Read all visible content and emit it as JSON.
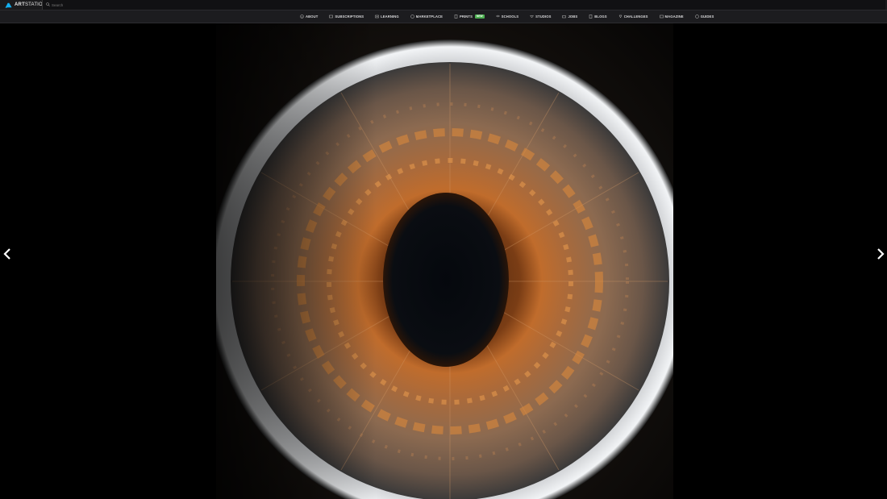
{
  "topbar": {
    "brand_prefix": "ART",
    "brand_suffix": "STATION",
    "search_placeholder": "Search"
  },
  "nav": {
    "items": [
      {
        "label": "ABOUT",
        "icon": "info-icon"
      },
      {
        "label": "SUBSCRIPTIONS",
        "icon": "card-icon"
      },
      {
        "label": "LEARNING",
        "icon": "play-icon"
      },
      {
        "label": "MARKETPLACE",
        "icon": "store-icon"
      },
      {
        "label": "PRINTS",
        "icon": "print-icon",
        "badge": "NEW"
      },
      {
        "label": "SCHOOLS",
        "icon": "school-icon"
      },
      {
        "label": "STUDIOS",
        "icon": "studio-icon"
      },
      {
        "label": "JOBS",
        "icon": "briefcase-icon"
      },
      {
        "label": "BLOGS",
        "icon": "blog-icon"
      },
      {
        "label": "CHALLENGES",
        "icon": "trophy-icon"
      },
      {
        "label": "MAGAZINE",
        "icon": "magazine-icon"
      },
      {
        "label": "GUIDES",
        "icon": "guide-icon"
      }
    ]
  },
  "viewer": {
    "artwork": "iris-closeup",
    "prev_icon": "chevron-left-icon",
    "next_icon": "chevron-right-icon"
  },
  "colors": {
    "brand": "#13aff0",
    "badge": "#4caf50",
    "background": "#000000",
    "topbar": "#1a1a1c"
  }
}
